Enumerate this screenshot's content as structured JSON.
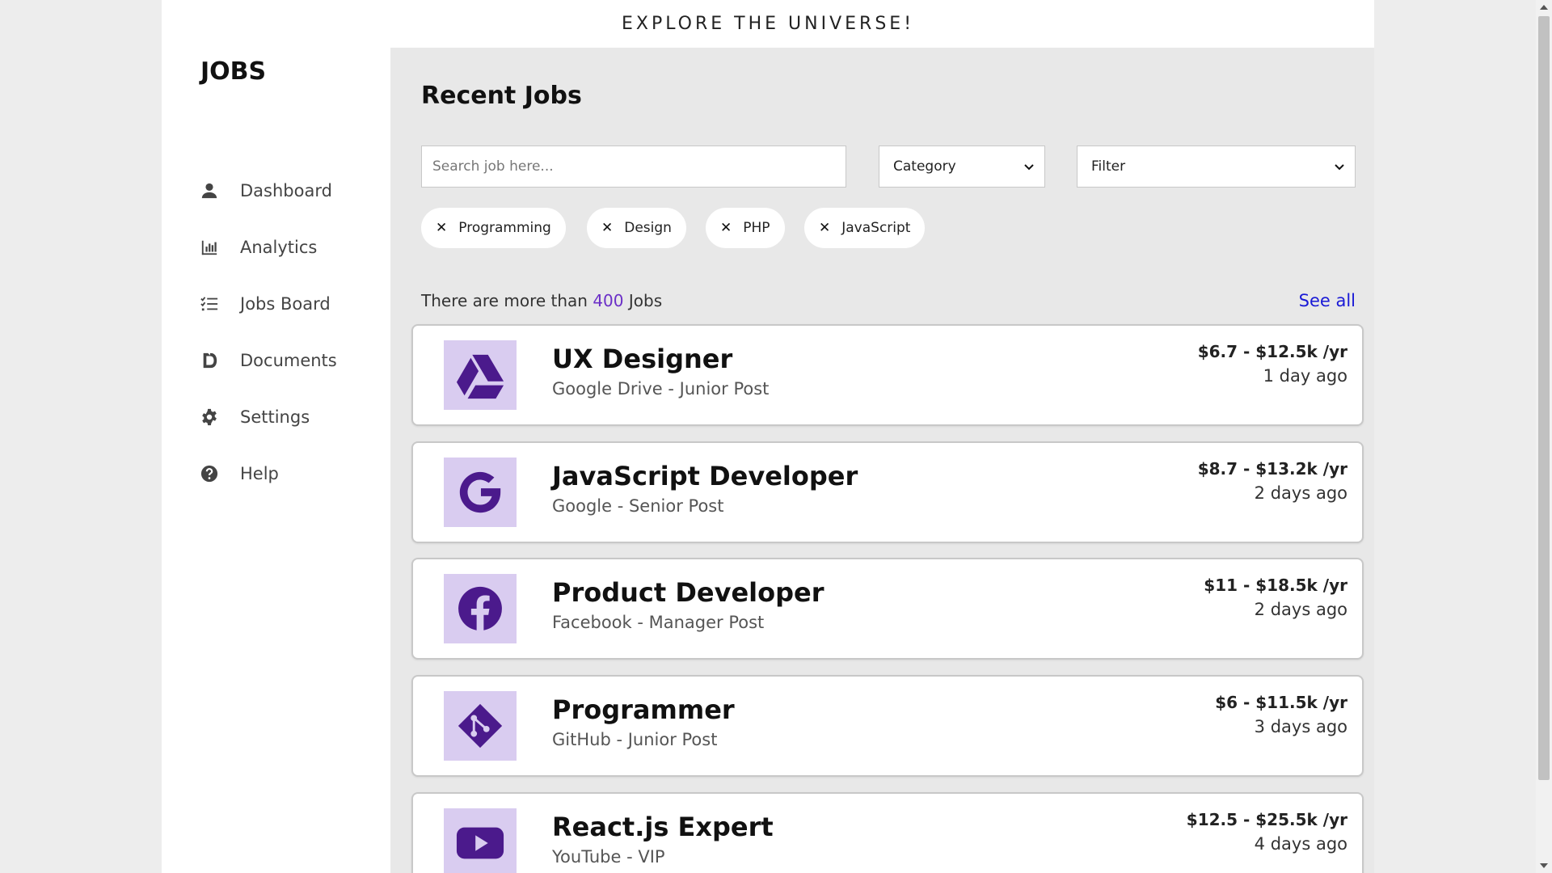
{
  "banner": {
    "text": "EXPLORE THE UNIVERSE!"
  },
  "sidebar": {
    "logo": "JOBS",
    "items": [
      {
        "label": "Dashboard",
        "icon": "user-icon"
      },
      {
        "label": "Analytics",
        "icon": "bar-chart-icon"
      },
      {
        "label": "Jobs Board",
        "icon": "list-icon"
      },
      {
        "label": "Documents",
        "icon": "document-icon"
      },
      {
        "label": "Settings",
        "icon": "gear-icon"
      },
      {
        "label": "Help",
        "icon": "question-icon"
      }
    ]
  },
  "main": {
    "title": "Recent Jobs",
    "search_placeholder": "Search job here...",
    "category_label": "Category",
    "filter_label": "Filter",
    "chips": [
      "Programming",
      "Design",
      "PHP",
      "JavaScript"
    ],
    "count_prefix": "There are more than",
    "count_value": "400",
    "count_suffix": "Jobs",
    "see_all": "See all"
  },
  "jobs": [
    {
      "title": "UX Designer",
      "company": "Google Drive - Junior Post",
      "salary": "$6.7 - $12.5k /yr",
      "posted": "1 day ago",
      "icon": "google-drive-icon"
    },
    {
      "title": "JavaScript Developer",
      "company": "Google - Senior Post",
      "salary": "$8.7 - $13.2k /yr",
      "posted": "2 days ago",
      "icon": "google-icon"
    },
    {
      "title": "Product Developer",
      "company": "Facebook - Manager Post",
      "salary": "$11 - $18.5k /yr",
      "posted": "2 days ago",
      "icon": "facebook-icon"
    },
    {
      "title": "Programmer",
      "company": "GitHub - Junior Post",
      "salary": "$6 - $11.5k /yr",
      "posted": "3 days ago",
      "icon": "git-icon"
    },
    {
      "title": "React.js Expert",
      "company": "YouTube - VIP",
      "salary": "$12.5 - $25.5k /yr",
      "posted": "4 days ago",
      "icon": "youtube-icon"
    }
  ],
  "colors": {
    "accent": "#6b2fc7",
    "link": "#1a1ad6",
    "logo_bg": "#d9ccf0",
    "logo_fg": "#4b1a8c"
  }
}
